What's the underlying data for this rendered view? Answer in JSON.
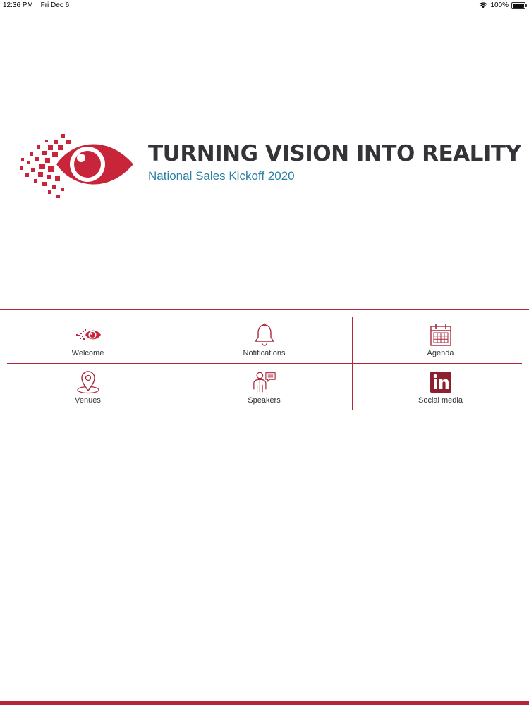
{
  "status_bar": {
    "time": "12:36 PM",
    "date": "Fri Dec 6",
    "battery": "100%",
    "battery_level": 1.0
  },
  "hero": {
    "title": "TURNING VISION INTO REALITY",
    "subtitle": "National Sales Kickoff 2020"
  },
  "menu": {
    "items": [
      {
        "label": "Welcome",
        "icon": "eye-icon"
      },
      {
        "label": "Notifications",
        "icon": "bell-icon"
      },
      {
        "label": "Agenda",
        "icon": "calendar-icon"
      },
      {
        "label": "Venues",
        "icon": "map-pin-icon"
      },
      {
        "label": "Speakers",
        "icon": "speaker-icon"
      },
      {
        "label": "Social media",
        "icon": "linkedin-icon"
      }
    ]
  },
  "colors": {
    "accent": "#b3263a",
    "subtitle": "#2a7fa4",
    "title": "#333338"
  }
}
